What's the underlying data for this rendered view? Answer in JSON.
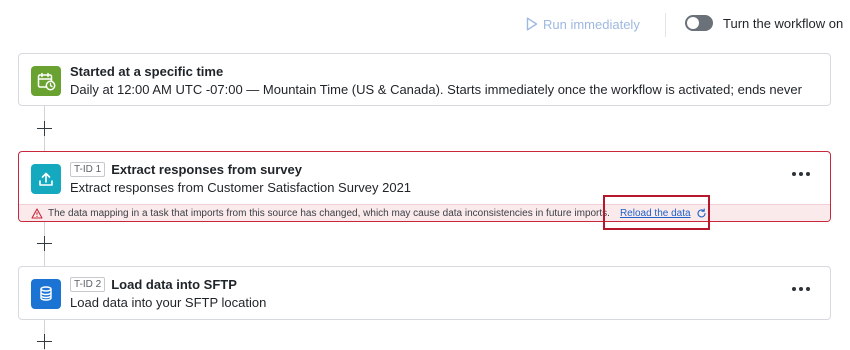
{
  "toolbar": {
    "run_label": "Run immediately",
    "toggle_label": "Turn the workflow on"
  },
  "trigger_card": {
    "title": "Started at a specific time",
    "subtitle": "Daily at 12:00 AM UTC -07:00 — Mountain Time (US & Canada). Starts immediately once the workflow is activated; ends never",
    "icon": "calendar-clock-icon",
    "icon_color": "#6aa232"
  },
  "task1": {
    "tid": "T-ID 1",
    "title": "Extract responses from survey",
    "subtitle": "Extract responses from Customer Satisfaction Survey 2021",
    "icon": "upload-icon",
    "icon_color": "#15a9c0",
    "warning_text": "The data mapping in a task that imports from this source has changed, which may cause data inconsistencies in future imports.",
    "reload_label": "Reload the data",
    "error_color": "#c8283c"
  },
  "task2": {
    "tid": "T-ID 2",
    "title": "Load data into SFTP",
    "subtitle": "Load data into your SFTP location",
    "icon": "database-icon",
    "icon_color": "#1b74d3"
  },
  "colors": {
    "accent": "#1d63c9",
    "disabled_accent": "#9db8e0",
    "highlight": "#b5172d"
  }
}
